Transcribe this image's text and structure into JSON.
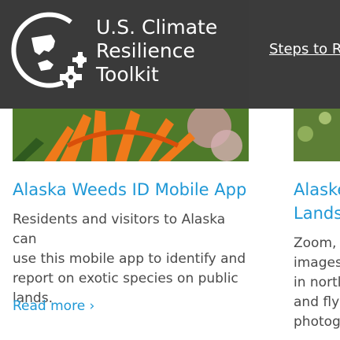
{
  "header": {
    "logo_lines": [
      "U.S. Climate",
      "Resilience",
      "Toolkit"
    ],
    "nav_link": "Steps to R"
  },
  "cards": [
    {
      "title": "Alaska Weeds ID Mobile App",
      "description_lines": [
        "Residents and visitors to Alaska can",
        "use this mobile app to identify and",
        "report on exotic species on public",
        "lands."
      ],
      "read_more": "Read more ›"
    },
    {
      "title_lines": [
        "Alaske",
        "Lands"
      ],
      "description_lines": [
        "Zoom,",
        "images",
        "in nortl",
        "and fly",
        "photog"
      ]
    }
  ],
  "colors": {
    "link": "#1f98d6",
    "body_text": "#4a4a4a",
    "header_bg": "#3a3a3a"
  }
}
